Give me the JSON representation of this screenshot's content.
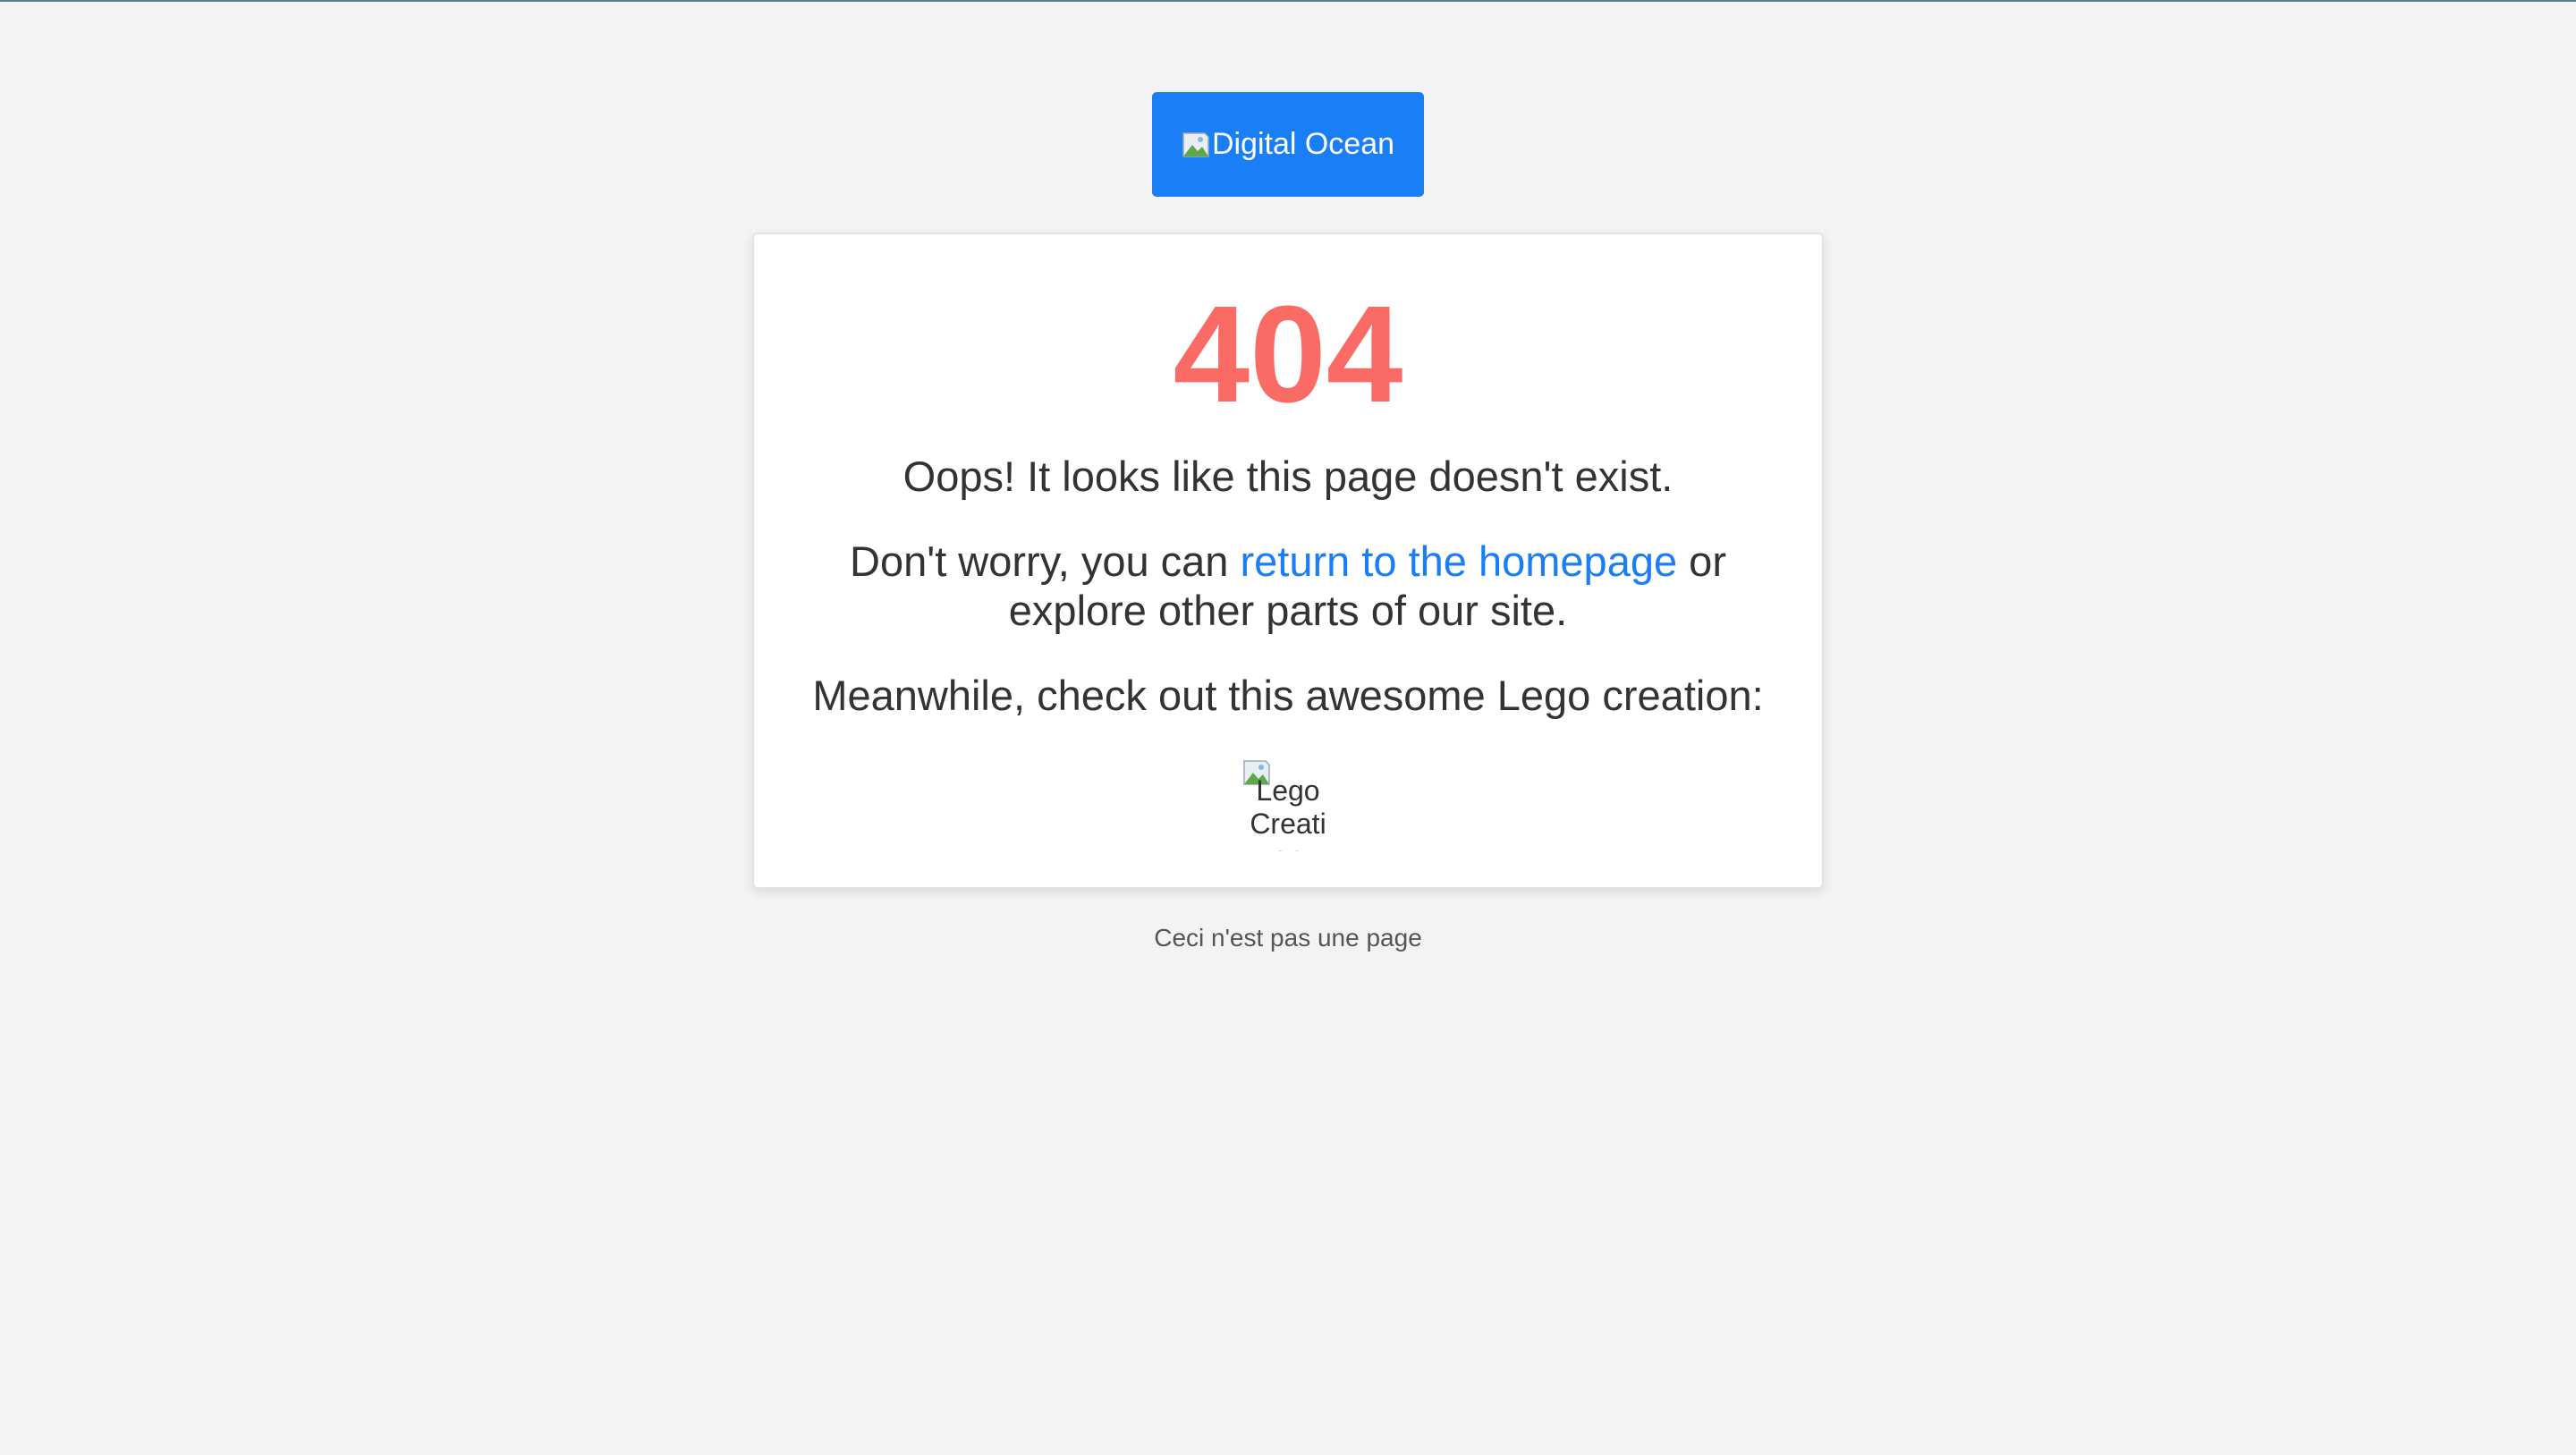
{
  "header": {
    "logo_alt": "Digital Ocean",
    "logo_bg_color": "#1a7ef7"
  },
  "error_card": {
    "code": "404",
    "code_color": "#fb6b65",
    "oops_message": "Oops! It looks like this page doesn't exist.",
    "worry_prefix": "Don't worry, you can ",
    "homepage_link": "return to the homepage",
    "worry_suffix": " or explore other parts of our site.",
    "lego_message": "Meanwhile, check out this awesome Lego creation:",
    "lego_image_alt": "Lego Creation"
  },
  "footer": {
    "text": "Ceci n'est pas une page"
  }
}
